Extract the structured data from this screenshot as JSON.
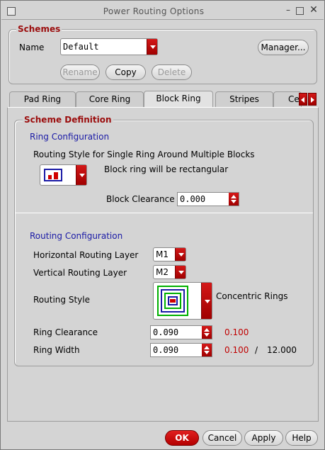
{
  "window": {
    "title": "Power Routing Options"
  },
  "schemes": {
    "title": "Schemes",
    "name_label": "Name",
    "name_value": "Default",
    "manager_label": "Manager...",
    "rename_label": "Rename",
    "copy_label": "Copy",
    "delete_label": "Delete"
  },
  "tabs": [
    {
      "label": "Pad Ring"
    },
    {
      "label": "Core Ring"
    },
    {
      "label": "Block Ring",
      "active": true
    },
    {
      "label": "Stripes"
    },
    {
      "label": "Ce"
    }
  ],
  "scheme_def": {
    "title": "Scheme Definition",
    "ring_config_title": "Ring Configuration",
    "routing_style_single": "Routing Style for Single Ring Around Multiple Blocks",
    "block_ring_desc": "Block ring will be rectangular",
    "block_clearance_label": "Block Clearance",
    "block_clearance_value": "0.000",
    "routing_config_title": "Routing Configuration",
    "h_layer_label": "Horizontal Routing Layer",
    "h_layer_value": "M1",
    "v_layer_label": "Vertical Routing Layer",
    "v_layer_value": "M2",
    "routing_style_label": "Routing Style",
    "routing_style_value": "Concentric Rings",
    "ring_clearance_label": "Ring Clearance",
    "ring_clearance_value": "0.090",
    "ring_clearance_min": "0.100",
    "ring_width_label": "Ring Width",
    "ring_width_value": "0.090",
    "ring_width_min": "0.100",
    "ring_width_sep": "/",
    "ring_width_max": "12.000"
  },
  "footer": {
    "ok": "OK",
    "cancel": "Cancel",
    "apply": "Apply",
    "help": "Help"
  }
}
